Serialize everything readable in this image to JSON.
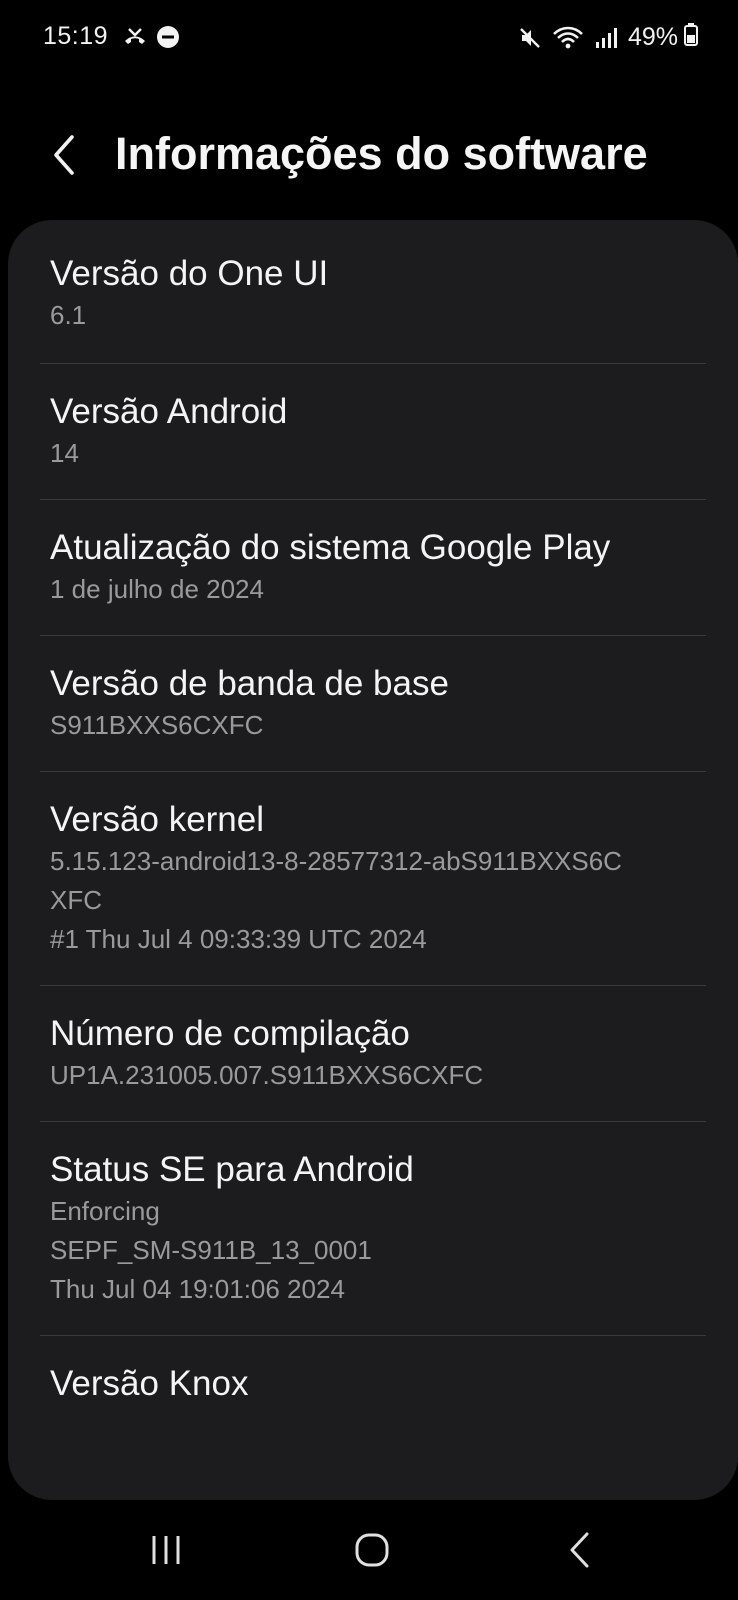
{
  "status_bar": {
    "time": "15:19",
    "left_icons": [
      "missed-call-icon",
      "do-not-disturb-icon"
    ],
    "right_icons": [
      "mute-icon",
      "wifi-icon",
      "signal-icon"
    ],
    "battery_percent": "49%"
  },
  "header": {
    "title": "Informações do software",
    "back_icon": "back-chevron-icon"
  },
  "items": [
    {
      "title": "Versão do One UI",
      "lines": [
        "6.1"
      ]
    },
    {
      "title": "Versão Android",
      "lines": [
        "14"
      ]
    },
    {
      "title": "Atualização do sistema Google Play",
      "lines": [
        "1 de julho de 2024"
      ]
    },
    {
      "title": "Versão de banda de base",
      "lines": [
        "S911BXXS6CXFC"
      ]
    },
    {
      "title": "Versão kernel",
      "lines": [
        "5.15.123-android13-8-28577312-abS911BXXS6C",
        "XFC",
        "#1 Thu Jul 4 09:33:39 UTC 2024"
      ]
    },
    {
      "title": "Número de compilação",
      "lines": [
        "UP1A.231005.007.S911BXXS6CXFC"
      ]
    },
    {
      "title": "Status SE para Android",
      "lines": [
        "Enforcing",
        "SEPF_SM-S911B_13_0001",
        "Thu Jul 04 19:01:06 2024"
      ]
    },
    {
      "title": "Versão Knox",
      "lines": []
    }
  ],
  "nav_bar": {
    "icons": [
      "recent-apps-icon",
      "home-icon",
      "back-icon"
    ]
  },
  "colors": {
    "background": "#000000",
    "card": "#1c1c1e",
    "title_text": "#f4f4f4",
    "sub_text": "#9a9a9a",
    "divider": "#3a3a3c"
  }
}
